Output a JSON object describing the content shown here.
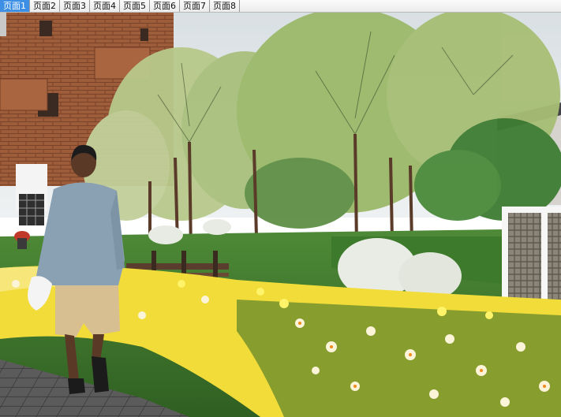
{
  "tabs": [
    {
      "label": "页面1",
      "active": true
    },
    {
      "label": "页面2",
      "active": false
    },
    {
      "label": "页面3",
      "active": false
    },
    {
      "label": "页面4",
      "active": false
    },
    {
      "label": "页面5",
      "active": false
    },
    {
      "label": "页面6",
      "active": false
    },
    {
      "label": "页面7",
      "active": false
    },
    {
      "label": "页面8",
      "active": false
    }
  ],
  "colors": {
    "active_tab": "#3d8fe6",
    "sky": "#dfe6ea",
    "brick": "#9a5a38",
    "foliage": "#9bb96a",
    "lawn": "#3f7a2e",
    "flowers": "#f2dc3a"
  }
}
